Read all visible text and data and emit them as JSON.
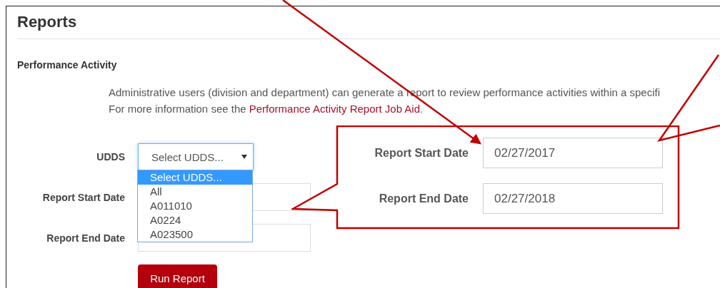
{
  "page": {
    "title": "Reports",
    "section": "Performance Activity",
    "description": "Administrative users (division and department) can generate a report to review performance activities within a specifi",
    "more_info": {
      "text": "For more information see the ",
      "link": "Performance Activity Report Job Aid",
      "after": "."
    }
  },
  "form": {
    "udds": {
      "label": "UDDS",
      "value": "Select UDDS...",
      "expanded": true,
      "options": [
        {
          "label": "Select UDDS...",
          "selected": true
        },
        {
          "label": "All",
          "selected": false
        },
        {
          "label": "A011010",
          "selected": false
        },
        {
          "label": "A0224",
          "selected": false
        },
        {
          "label": "A023500",
          "selected": false
        }
      ]
    },
    "start_date": {
      "label": "Report Start Date"
    },
    "end_date": {
      "label": "Report End Date"
    },
    "button": "Run Report"
  },
  "callout": {
    "fields": [
      {
        "label": "Report Start Date",
        "value": "02/27/2017"
      },
      {
        "label": "Report End Date",
        "value": "02/27/2018"
      }
    ]
  }
}
